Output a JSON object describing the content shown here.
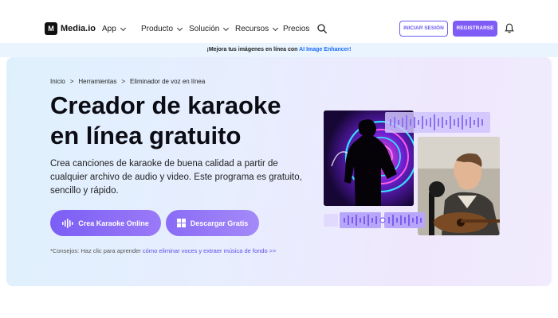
{
  "nav": {
    "logo_mark": "M",
    "brand": "Media.io",
    "items": [
      {
        "label": "App",
        "has_dropdown": true
      },
      {
        "label": "Producto",
        "has_dropdown": true
      },
      {
        "label": "Solución",
        "has_dropdown": true
      },
      {
        "label": "Recursos",
        "has_dropdown": true
      },
      {
        "label": "Precios",
        "has_dropdown": false
      }
    ],
    "login_label": "INICIAR SESIÓN",
    "register_label": "REGISTRARSE"
  },
  "banner": {
    "text": "¡Mejora tus imágenes en línea con",
    "link": "AI Image Enhancer!"
  },
  "hero": {
    "breadcrumb": [
      "Inicio",
      ">",
      "Herramientas",
      ">",
      "Eliminador de voz en línea"
    ],
    "title_line1": "Creador de karaoke",
    "title_line2": "en línea gratuito",
    "description": "Crea canciones de karaoke de buena calidad a partir de cualquier archivo de audio y video. Este programa es gratuito, sencillo y rápido.",
    "cta_primary": "Crea Karaoke Online",
    "cta_secondary": "Descargar Gratis",
    "tips_prefix": "*Consejos: Haz clic para aprender",
    "tips_link": "cómo eliminar voces y extraer música de fondo >>"
  },
  "colors": {
    "accent": "#7f5cf6",
    "link": "#1d6cf5",
    "hero_start": "#dff0fd",
    "hero_end": "#f1ebfd"
  }
}
